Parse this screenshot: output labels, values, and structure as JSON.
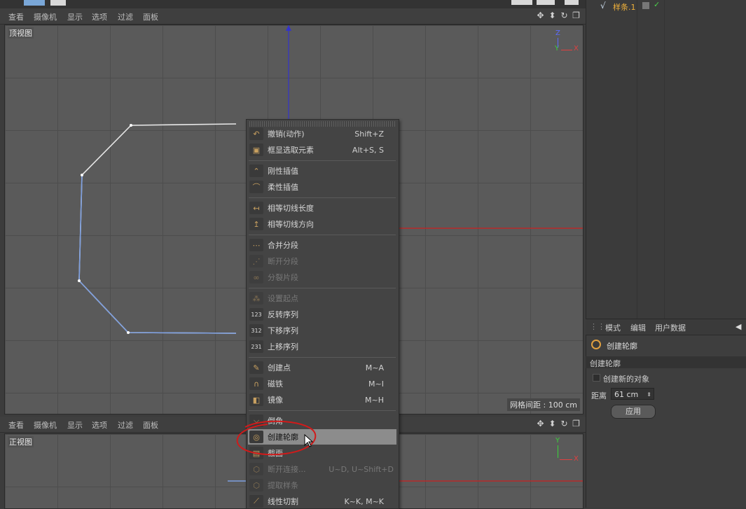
{
  "top_menu": [
    "查看",
    "摄像机",
    "显示",
    "选项",
    "过滤",
    "面板"
  ],
  "bottom_menu": [
    "查看",
    "摄像机",
    "显示",
    "选项",
    "过滤",
    "面板"
  ],
  "top_viewport": {
    "label": "顶视图",
    "grid_spacing": "网格间距 : 100 cm",
    "axis_z": "Z",
    "axis_y": "Y",
    "axis_x": "X"
  },
  "front_viewport": {
    "label": "正视图",
    "axis_y": "Y",
    "axis_x": "X"
  },
  "object_manager": {
    "item": "样条.1"
  },
  "context_menu": {
    "items": [
      {
        "label": "撤销(动作)",
        "shortcut": "Shift+Z",
        "icon": "undo-icon",
        "disabled": false
      },
      {
        "label": "框显选取元素",
        "shortcut": "Alt+S, S",
        "icon": "frame-selected-icon",
        "disabled": false
      },
      {
        "label": "刚性插值",
        "shortcut": "",
        "icon": "hard-interpolation-icon",
        "disabled": false
      },
      {
        "label": "柔性插值",
        "shortcut": "",
        "icon": "soft-interpolation-icon",
        "disabled": false
      },
      {
        "label": "相等切线长度",
        "shortcut": "",
        "icon": "equal-tangent-length-icon",
        "disabled": false
      },
      {
        "label": "相等切线方向",
        "shortcut": "",
        "icon": "equal-tangent-direction-icon",
        "disabled": false
      },
      {
        "label": "合并分段",
        "shortcut": "",
        "icon": "join-segment-icon",
        "disabled": false
      },
      {
        "label": "断开分段",
        "shortcut": "",
        "icon": "break-segment-icon",
        "disabled": true
      },
      {
        "label": "分裂片段",
        "shortcut": "",
        "icon": "explode-segments-icon",
        "disabled": true
      },
      {
        "label": "设置起点",
        "shortcut": "",
        "icon": "set-first-point-icon",
        "disabled": true
      },
      {
        "label": "反转序列",
        "shortcut": "",
        "icon": "reverse-sequence-icon",
        "disabled": false
      },
      {
        "label": "下移序列",
        "shortcut": "",
        "icon": "move-down-sequence-icon",
        "disabled": false
      },
      {
        "label": "上移序列",
        "shortcut": "",
        "icon": "move-up-sequence-icon",
        "disabled": false
      },
      {
        "label": "创建点",
        "shortcut": "M~A",
        "icon": "create-point-icon",
        "disabled": false
      },
      {
        "label": "磁铁",
        "shortcut": "M~I",
        "icon": "magnet-icon",
        "disabled": false
      },
      {
        "label": "镜像",
        "shortcut": "M~H",
        "icon": "mirror-icon",
        "disabled": false
      },
      {
        "label": "倒角",
        "shortcut": "",
        "icon": "chamfer-icon",
        "disabled": false
      },
      {
        "label": "创建轮廓",
        "shortcut": "",
        "icon": "create-outline-icon",
        "disabled": false,
        "highlighted": true
      },
      {
        "label": "截面",
        "shortcut": "",
        "icon": "cross-section-icon",
        "disabled": false
      },
      {
        "label": "断开连接...",
        "shortcut": "U~D, U~Shift+D",
        "icon": "disconnect-icon",
        "disabled": true
      },
      {
        "label": "提取样条",
        "shortcut": "",
        "icon": "extract-spline-icon",
        "disabled": true
      },
      {
        "label": "线性切割",
        "shortcut": "K~K, M~K",
        "icon": "line-cut-icon",
        "disabled": false
      }
    ]
  },
  "attributes": {
    "tabs": [
      "模式",
      "编辑",
      "用户数据"
    ],
    "tool_name": "创建轮廓",
    "section_title": "创建轮廓",
    "checkbox_label": "创建新的对象",
    "distance_label": "距离",
    "distance_value": "61 cm",
    "apply_label": "应用"
  },
  "colors": {
    "accent_red": "#cc2222",
    "spline_white": "#e8e8e8",
    "spline_blue": "#6a8fd8"
  }
}
